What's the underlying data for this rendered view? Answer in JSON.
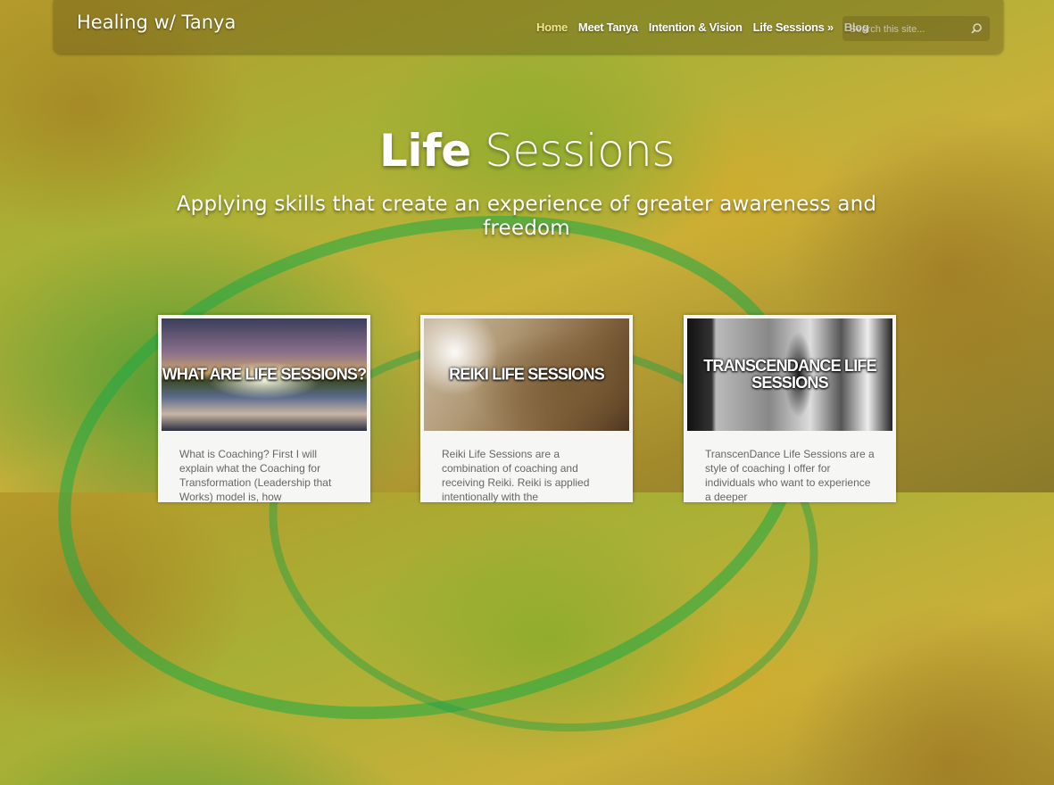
{
  "site": {
    "title": "Healing w/ Tanya"
  },
  "nav": {
    "items": [
      {
        "label": "Home"
      },
      {
        "label": "Meet Tanya"
      },
      {
        "label": "Intention & Vision"
      },
      {
        "label": "Life Sessions »"
      },
      {
        "label": "Blog"
      }
    ]
  },
  "search": {
    "placeholder": "Search this site..."
  },
  "hero": {
    "title_bold": "Life",
    "title_light": "Sessions",
    "subtitle": "Applying skills that create an experience of greater awareness and freedom"
  },
  "cards": [
    {
      "caption": "WHAT ARE LIFE SESSIONS?",
      "text": "What is Coaching? First I will explain what the Coaching for Transformation (Leadership that Works) model is, how"
    },
    {
      "caption": "REIKI LIFE SESSIONS",
      "text": "Reiki Life Sessions are a combination of coaching and receiving Reiki. Reiki is applied intentionally with the"
    },
    {
      "caption": "TRANSCENDANCE LIFE SESSIONS",
      "text": "TranscenDance Life Sessions are a style of coaching I offer for individuals who want to experience a deeper"
    }
  ],
  "colors": {
    "nav_active": "#f3e88a",
    "card_bg": "#f6f6f4",
    "card_text": "#666666"
  }
}
